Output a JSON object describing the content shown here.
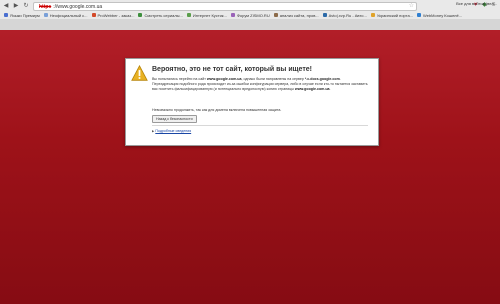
{
  "browser": {
    "url_scheme": "https",
    "url_rest": "://www.google.com.ua",
    "bookmarks": [
      {
        "label": "Языки Премиум",
        "color": "#4a6fd0"
      },
      {
        "label": "Неофициальный с...",
        "color": "#7aa0d8"
      },
      {
        "label": "ProWebber - заказ...",
        "color": "#d34a2a"
      },
      {
        "label": "Смотреть сериалы...",
        "color": "#3d8f3d"
      },
      {
        "label": "Интернет Кустик...",
        "color": "#5a9e4b"
      },
      {
        "label": "Форум ZISMO.RU",
        "color": "#9a63b8"
      },
      {
        "label": "анализ сайта, пров...",
        "color": "#8c6b4a"
      },
      {
        "label": "Avto|.xvp.Ru - Авто...",
        "color": "#2b6aa8"
      },
      {
        "label": "Украинский порта...",
        "color": "#e0a32a"
      },
      {
        "label": "WebMoney Кошелё...",
        "color": "#2f7fd0"
      }
    ],
    "other_bookmarks": "Все для вайтов (вел...",
    "ext_icons": [
      {
        "name": "heart-icon",
        "glyph": "♥",
        "color": "#d9364a"
      },
      {
        "name": "puzzle-icon",
        "glyph": "◆",
        "color": "#3a7d3a"
      },
      {
        "name": "wrench-icon",
        "glyph": "≡",
        "color": "#666666"
      }
    ]
  },
  "dialog": {
    "title": "Вероятно, это не тот сайт, который вы ищете!",
    "p1_a": "Вы попытались перейти на сайт ",
    "p1_host": "www.google.com.ua",
    "p1_b": ", однако были направлены на сервер ",
    "p1_cert": "*.c.docs.google.com",
    "p1_c": ". Переадресация подобного рода происходит из-за ошибки конфигурации сервера, либо в случае если кто-то пытается заставить вас посетить фальсифицированную (и потенциально вредоносную) копию страницы ",
    "p1_host2": "www.google.com.ua",
    "p1_d": ".",
    "note": "Невозможно продолжить, так как для домена включена повышенная защита.",
    "back_button": "Назад к безопасности",
    "details_link": "Подробные сведения"
  },
  "colors": {
    "page_bg": "#9e1219",
    "link": "#1a47a6"
  }
}
